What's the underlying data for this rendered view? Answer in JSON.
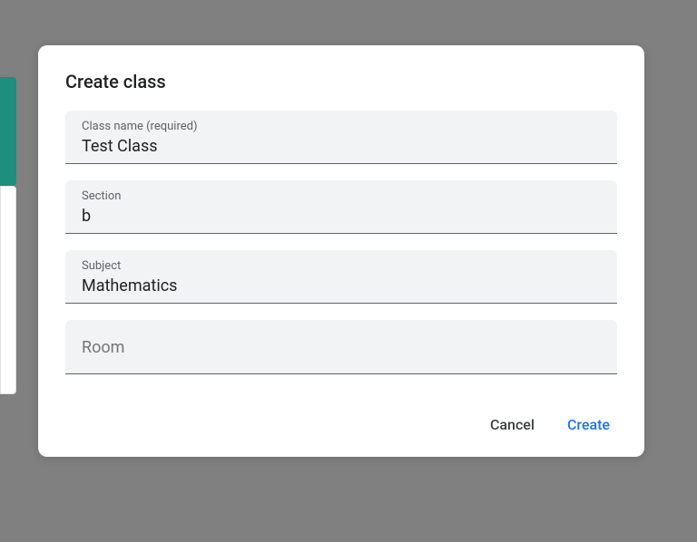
{
  "dialog": {
    "title": "Create class",
    "fields": {
      "class_name": {
        "label": "Class name (required)",
        "value": "Test Class"
      },
      "section": {
        "label": "Section",
        "value": "b"
      },
      "subject": {
        "label": "Subject",
        "value": "Mathematics"
      },
      "room": {
        "label": "Room",
        "value": ""
      }
    },
    "actions": {
      "cancel": "Cancel",
      "create": "Create"
    }
  }
}
